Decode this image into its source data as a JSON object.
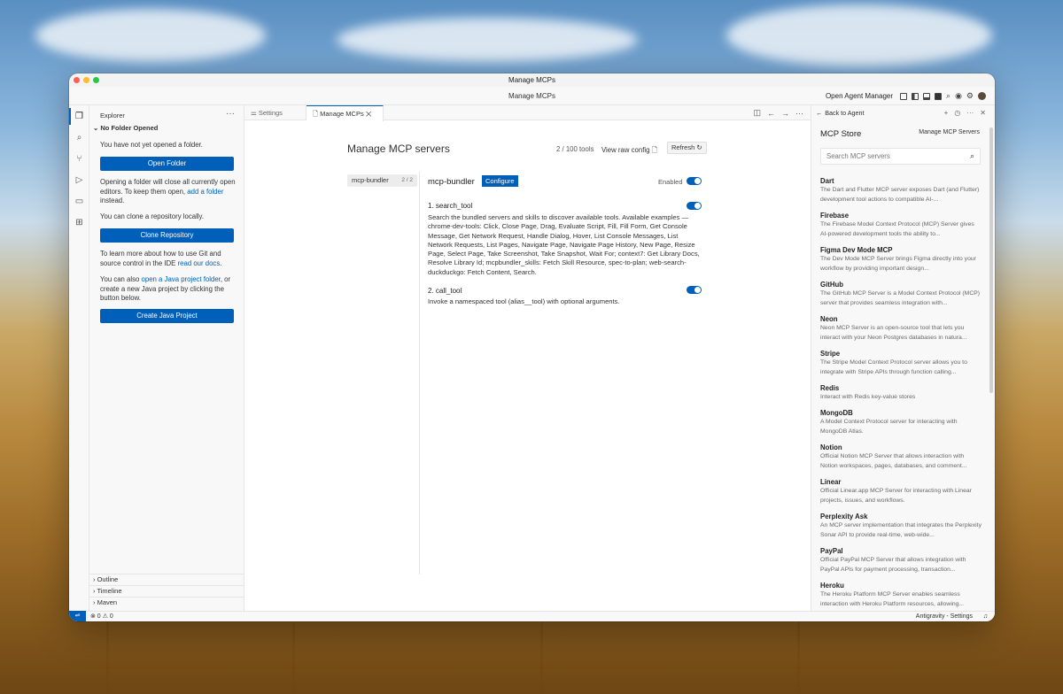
{
  "window": {
    "title": "Manage MCPs"
  },
  "command_bar": {
    "title": "Manage MCPs",
    "open_agent_manager": "Open Agent Manager"
  },
  "explorer": {
    "header": "Explorer",
    "section": "No Folder Opened",
    "not_opened_text": "You have not yet opened a folder.",
    "open_folder_button": "Open Folder",
    "close_editors_text": "Opening a folder will close all currently open editors. To keep them open,",
    "add_folder_link": "add a folder",
    "instead_text": "instead.",
    "clone_text": "You can clone a repository locally.",
    "clone_button": "Clone Repository",
    "git_text": "To learn more about how to use Git and source control in the IDE",
    "read_docs_link": "read our docs",
    "java_prefix": "You can also",
    "java_link": "open a Java project folder",
    "java_suffix": ", or create a new Java project by clicking the button below.",
    "create_java_button": "Create Java Project",
    "footers": [
      "Outline",
      "Timeline",
      "Maven"
    ]
  },
  "tabs": [
    {
      "label": "Settings"
    },
    {
      "label": "Manage MCPs"
    }
  ],
  "mcp": {
    "title": "Manage MCP servers",
    "tool_count": "2 / 100 tools",
    "view_raw": "View raw config",
    "refresh": "Refresh",
    "server_list": [
      {
        "name": "mcp-bundler",
        "count": "2 / 2"
      }
    ],
    "server": {
      "name": "mcp-bundler",
      "configure": "Configure",
      "enabled_label": "Enabled",
      "enabled": true,
      "tools": [
        {
          "name": "1. search_tool",
          "enabled": true,
          "description": "Search the bundled servers and skills to discover available tools. Available examples — chrome-dev-tools: Click, Close Page, Drag, Evaluate Script, Fill, Fill Form, Get Console Message, Get Network Request, Handle Dialog, Hover, List Console Messages, List Network Requests, List Pages, Navigate Page, Navigate Page History, New Page, Resize Page, Select Page, Take Screenshot, Take Snapshot, Wait For; context7: Get Library Docs, Resolve Library Id; mcpbundler_skills: Fetch Skill Resource, spec-to-plan; web-search-duckduckgo: Fetch Content, Search."
        },
        {
          "name": "2. call_tool",
          "enabled": true,
          "description": "Invoke a namespaced tool (alias__tool) with optional arguments."
        }
      ]
    }
  },
  "store": {
    "back": "Back to Agent",
    "title": "MCP Store",
    "manage": "Manage MCP Servers",
    "search_placeholder": "Search MCP servers",
    "items": [
      {
        "name": "Dart",
        "desc": "The Dart and Flutter MCP server exposes Dart (and Flutter) development tool actions to compatible AI-..."
      },
      {
        "name": "Firebase",
        "desc": "The Firebase Model Context Protocol (MCP) Server gives AI-powered development tools the ability to..."
      },
      {
        "name": "Figma Dev Mode MCP",
        "desc": "The Dev Mode MCP Server brings Figma directly into your workflow by providing important design..."
      },
      {
        "name": "GitHub",
        "desc": "The GitHub MCP Server is a Model Context Protocol (MCP) server that provides seamless integration with..."
      },
      {
        "name": "Neon",
        "desc": "Neon MCP Server is an open-source tool that lets you interact with your Neon Postgres databases in natura..."
      },
      {
        "name": "Stripe",
        "desc": "The Stripe Model Context Protocol server allows you to integrate with Stripe APIs through function calling..."
      },
      {
        "name": "Redis",
        "desc": "Interact with Redis key-value stores"
      },
      {
        "name": "MongoDB",
        "desc": "A Model Context Protocol server for interacting with MongoDB Atlas."
      },
      {
        "name": "Notion",
        "desc": "Official Notion MCP Server that allows interaction with Notion workspaces, pages, databases, and comment..."
      },
      {
        "name": "Linear",
        "desc": "Official Linear.app MCP Server for interacting with Linear projects, issues, and workflows."
      },
      {
        "name": "Perplexity Ask",
        "desc": "An MCP server implementation that integrates the Perplexity Sonar API to provide real-time, web-wide..."
      },
      {
        "name": "PayPal",
        "desc": "Official PayPal MCP Server that allows integration with PayPal APIs for payment processing, transaction..."
      },
      {
        "name": "Heroku",
        "desc": "The Heroku Platform MCP Server enables seamless interaction with Heroku Platform resources, allowing..."
      }
    ]
  },
  "status": {
    "problems": "⊗ 0 ⚠ 0",
    "right": "Antigravity - Settings"
  },
  "icons": {
    "remote": "remote-icon",
    "explorer": "files-icon",
    "search": "search-icon",
    "source_control": "source-control-icon",
    "run": "run-debug-icon",
    "remote_explorer": "remote-explorer-icon",
    "extensions": "extensions-icon"
  },
  "colors": {
    "accent": "#005fb8",
    "panel": "#f8f8f8"
  }
}
